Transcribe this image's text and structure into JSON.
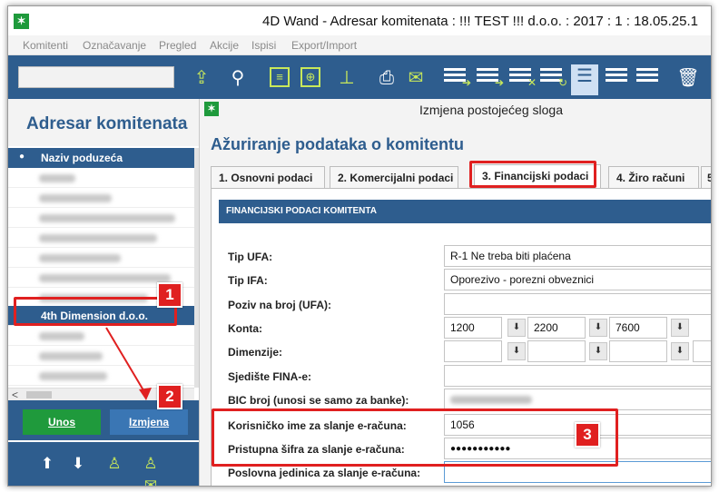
{
  "window": {
    "title": "4D Wand - Adresar komitenata : !!! TEST !!! d.o.o. : 2017 : 1 : 18.05.25.1",
    "app_icon": "✶"
  },
  "menu": [
    "Komitenti",
    "Označavanje",
    "Pregled",
    "Akcije",
    "Ispisi",
    "Export/Import"
  ],
  "toolbar": {
    "icons": [
      "export-icon",
      "search-icon",
      "note-icon",
      "globe-icon",
      "pin-icon",
      "print-icon",
      "mail-icon",
      "list-arrow-icon",
      "list-arrow-icon",
      "list-delete-icon",
      "list-refresh-icon",
      "list-view-icon",
      "list-view-icon",
      "list-view-icon",
      "trash-icon"
    ]
  },
  "left_panel": {
    "title": "Adresar komitenata",
    "column_header": "Naziv poduzeća",
    "selected_row": "4th Dimension d.o.o.",
    "buttons": {
      "new": "Unos",
      "edit": "Izmjena"
    },
    "scroll_left": "<"
  },
  "dialog": {
    "title": "Izmjena postojećeg sloga",
    "heading": "Ažuriranje podataka o komitentu",
    "tabs": [
      {
        "label": "1. Osnovni podaci"
      },
      {
        "label": "2. Komercijalni podaci"
      },
      {
        "label": "3. Financijski podaci"
      },
      {
        "label": "4. Žiro računi"
      },
      {
        "label": "5."
      }
    ],
    "section": "FINANCIJSKI PODACI KOMITENTA",
    "fields": {
      "tip_ufa": {
        "label": "Tip UFA:",
        "value": "R-1 Ne treba biti plaćena"
      },
      "tip_ifa": {
        "label": "Tip IFA:",
        "value": "Oporezivo - porezni obveznici"
      },
      "poziv": {
        "label": "Poziv na broj (UFA):",
        "value": ""
      },
      "konta": {
        "label": "Konta:",
        "values": [
          "1200",
          "2200",
          "7600"
        ]
      },
      "dimenzije": {
        "label": "Dimenzije:"
      },
      "sjediste": {
        "label": "Sjedište FINA-e:",
        "value": ""
      },
      "bic": {
        "label": "BIC broj (unosi se samo za banke):"
      },
      "username": {
        "label": "Korisničko ime za slanje e-računa:",
        "value": "1056"
      },
      "password": {
        "label": "Pristupna šifra za slanje e-računa:",
        "value": "●●●●●●●●●●●"
      },
      "poslovna": {
        "label": "Poslovna jedinica za slanje e-računa:"
      }
    }
  },
  "annotations": [
    "1",
    "2",
    "3"
  ],
  "colors": {
    "primary": "#2e5d8e",
    "green": "#1f9a3c",
    "highlight": "#e02020"
  }
}
